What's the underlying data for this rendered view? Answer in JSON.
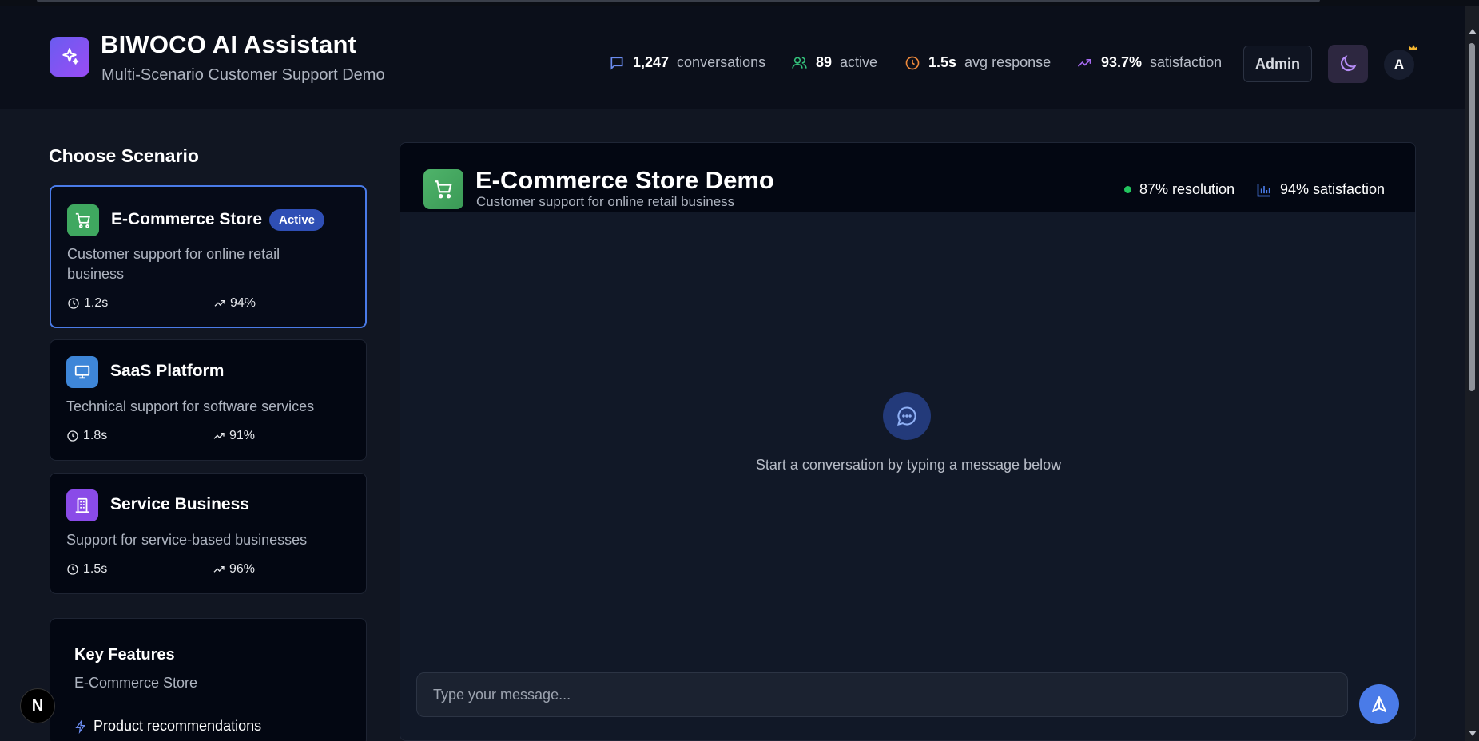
{
  "header": {
    "title": "BIWOCO AI Assistant",
    "subtitle": "Multi-Scenario Customer Support Demo",
    "stats": [
      {
        "icon": "message-icon",
        "value": "1,247",
        "label": "conversations",
        "color": "#6b8cf0"
      },
      {
        "icon": "users-icon",
        "value": "89",
        "label": "active",
        "color": "#34c07a"
      },
      {
        "icon": "clock-icon",
        "value": "1.5s",
        "label": "avg response",
        "color": "#f08a3c"
      },
      {
        "icon": "trending-up-icon",
        "value": "93.7%",
        "label": "satisfaction",
        "color": "#a66af0"
      }
    ],
    "admin_label": "Admin",
    "avatar_initial": "A"
  },
  "sidebar": {
    "title": "Choose Scenario",
    "scenarios": [
      {
        "name": "E-Commerce Store",
        "badge": "Active",
        "description": "Customer support for online retail business",
        "time": "1.2s",
        "rate": "94%",
        "icon": "cart-icon",
        "color": "#3fa860",
        "active": true
      },
      {
        "name": "SaaS Platform",
        "description": "Technical support for software services",
        "time": "1.8s",
        "rate": "91%",
        "icon": "monitor-icon",
        "color": "#3e86d8",
        "active": false
      },
      {
        "name": "Service Business",
        "description": "Support for service-based businesses",
        "time": "1.5s",
        "rate": "96%",
        "icon": "building-icon",
        "color": "#8a4be8",
        "active": false
      }
    ],
    "features": {
      "title": "Key Features",
      "subtitle": "E-Commerce Store",
      "items": [
        "Product recommendations"
      ]
    }
  },
  "chat": {
    "title": "E-Commerce Store Demo",
    "subtitle": "Customer support for online retail business",
    "resolution": "87% resolution",
    "satisfaction": "94% satisfaction",
    "empty_text": "Start a conversation by typing a message below",
    "input_placeholder": "Type your message..."
  },
  "floating_badge": "N",
  "colors": {
    "accent": "#4a7be8",
    "background": "#111622",
    "card": "#030712"
  }
}
